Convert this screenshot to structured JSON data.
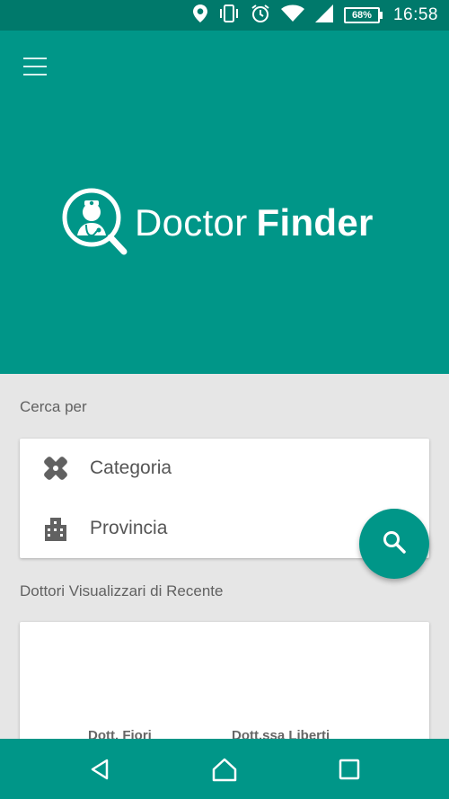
{
  "status_bar": {
    "battery": "68%",
    "time": "16:58"
  },
  "app": {
    "logo_word1": "Doctor",
    "logo_word2": "Finder"
  },
  "search": {
    "section_label": "Cerca per",
    "options": [
      {
        "label": "Categoria",
        "icon": "bandage-icon"
      },
      {
        "label": "Provincia",
        "icon": "city-icon"
      }
    ]
  },
  "recent": {
    "section_label": "Dottori Visualizzari di Recente",
    "doctors": [
      {
        "name": "Dott. Fiori"
      },
      {
        "name": "Dott.ssa Liberti"
      }
    ]
  },
  "colors": {
    "primary": "#009688",
    "primary_dark": "#00796b",
    "background": "#e6e6e6"
  }
}
